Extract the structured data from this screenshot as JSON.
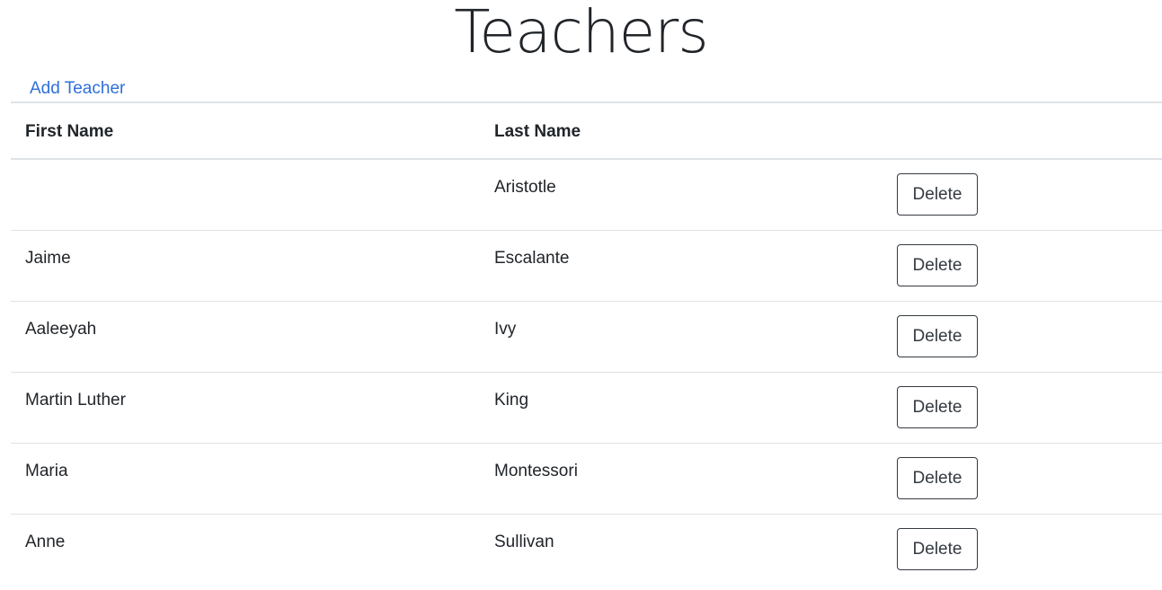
{
  "page": {
    "title": "Teachers",
    "add_link": "Add Teacher"
  },
  "table": {
    "headers": {
      "first_name": "First Name",
      "last_name": "Last Name",
      "actions": ""
    },
    "rows": [
      {
        "first_name": "",
        "last_name": "Aristotle",
        "action": "Delete"
      },
      {
        "first_name": "Jaime",
        "last_name": "Escalante",
        "action": "Delete"
      },
      {
        "first_name": "Aaleeyah",
        "last_name": "Ivy",
        "action": "Delete"
      },
      {
        "first_name": "Martin Luther",
        "last_name": "King",
        "action": "Delete"
      },
      {
        "first_name": "Maria",
        "last_name": "Montessori",
        "action": "Delete"
      },
      {
        "first_name": "Anne",
        "last_name": "Sullivan",
        "action": "Delete"
      }
    ]
  },
  "colors": {
    "link": "#2f6fdb",
    "text": "#212529",
    "border": "#dee2e6",
    "button_border": "#343a40"
  }
}
